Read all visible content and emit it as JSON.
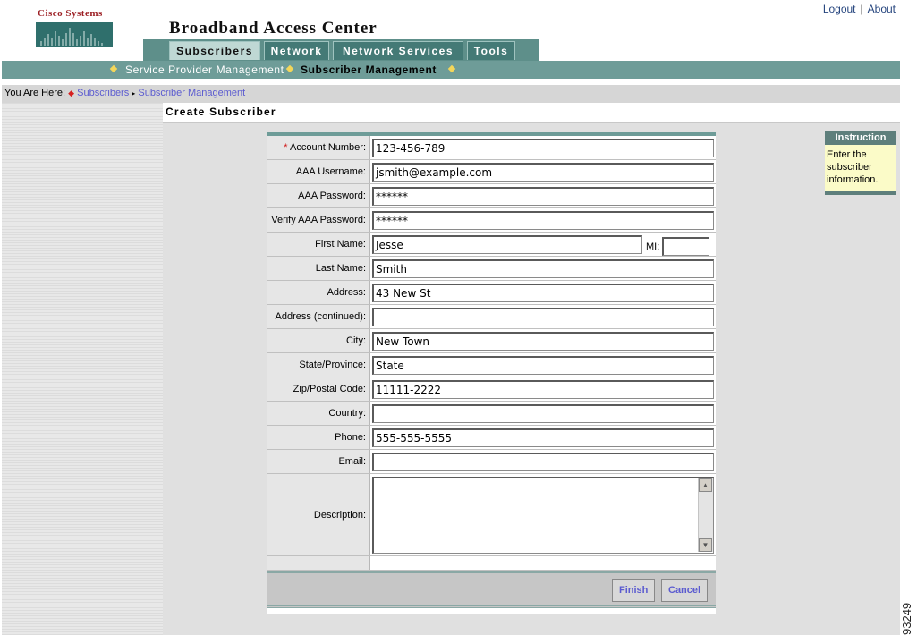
{
  "header": {
    "logo_text": "Cisco Systems",
    "app_title": "Broadband Access Center",
    "links": [
      "Logout",
      "About"
    ]
  },
  "tabs": [
    "Subscribers",
    "Network",
    "Network Services",
    "Tools"
  ],
  "subnav": [
    "Service Provider Management",
    "Subscriber Management"
  ],
  "breadcrumb": {
    "prefix": "You Are Here:",
    "items": [
      "Subscribers",
      "Subscriber Management"
    ]
  },
  "page_title": "Create Subscriber",
  "form": {
    "required_marker": "*",
    "fields": [
      {
        "label": "Account Number:",
        "value": "123-456-789"
      },
      {
        "label": "AAA Username:",
        "value": "jsmith@example.com"
      },
      {
        "label": "AAA Password:",
        "value": "******"
      },
      {
        "label": "Verify AAA Password:",
        "value": "******"
      },
      {
        "label": "First Name:",
        "value": "Jesse"
      },
      {
        "label": "Last Name:",
        "value": "Smith"
      },
      {
        "label": "Address:",
        "value": "43 New St"
      },
      {
        "label": "Address (continued):",
        "value": ""
      },
      {
        "label": "City:",
        "value": "New Town"
      },
      {
        "label": "State/Province:",
        "value": "State"
      },
      {
        "label": "Zip/Postal Code:",
        "value": "11111-2222"
      },
      {
        "label": "Country:",
        "value": ""
      },
      {
        "label": "Phone:",
        "value": "555-555-5555"
      },
      {
        "label": "Email:",
        "value": ""
      }
    ],
    "mi_label": "MI:",
    "mi_value": "",
    "description_label": "Description:",
    "description_value": "",
    "finish_label": "Finish",
    "cancel_label": "Cancel"
  },
  "instruction": {
    "title": "Instruction",
    "text": "Enter the subscriber information."
  },
  "figure_number": "93249",
  "colors": {
    "teal": "#6e9c98",
    "dark_teal": "#447a76",
    "link_blue": "#5b5bd0",
    "logo_red": "#9c1f24",
    "instruction_bg": "#fbfbc8"
  }
}
